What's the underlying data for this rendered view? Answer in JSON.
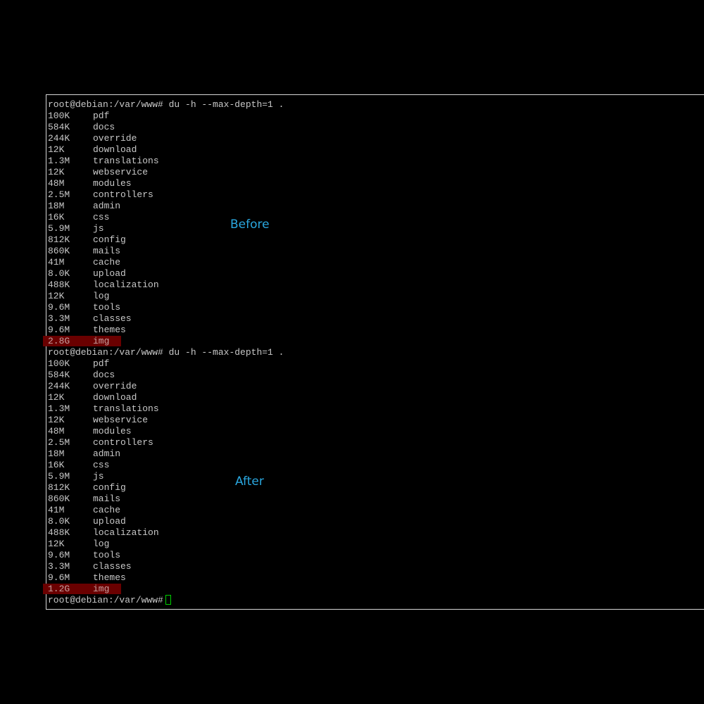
{
  "prompt": "root@debian:/var/www#",
  "command": " du -h --max-depth=1 .",
  "before_label": "Before",
  "after_label": "After",
  "colors": {
    "accent": "#2aa7df",
    "highlight": "#6a0000",
    "cursor": "#00d000",
    "text": "#c8c8c8"
  },
  "before_rows": [
    {
      "size": "100K",
      "name": "pdf"
    },
    {
      "size": "584K",
      "name": "docs"
    },
    {
      "size": "244K",
      "name": "override"
    },
    {
      "size": "12K",
      "name": "download"
    },
    {
      "size": "1.3M",
      "name": "translations"
    },
    {
      "size": "12K",
      "name": "webservice"
    },
    {
      "size": "48M",
      "name": "modules"
    },
    {
      "size": "2.5M",
      "name": "controllers"
    },
    {
      "size": "18M",
      "name": "admin"
    },
    {
      "size": "16K",
      "name": "css"
    },
    {
      "size": "5.9M",
      "name": "js"
    },
    {
      "size": "812K",
      "name": "config"
    },
    {
      "size": "860K",
      "name": "mails"
    },
    {
      "size": "41M",
      "name": "cache"
    },
    {
      "size": "8.0K",
      "name": "upload"
    },
    {
      "size": "488K",
      "name": "localization"
    },
    {
      "size": "12K",
      "name": "log"
    },
    {
      "size": "9.6M",
      "name": "tools"
    },
    {
      "size": "3.3M",
      "name": "classes"
    },
    {
      "size": "9.6M",
      "name": "themes"
    },
    {
      "size": "2.8G",
      "name": "img",
      "highlight": true
    }
  ],
  "after_rows": [
    {
      "size": "100K",
      "name": "pdf"
    },
    {
      "size": "584K",
      "name": "docs"
    },
    {
      "size": "244K",
      "name": "override"
    },
    {
      "size": "12K",
      "name": "download"
    },
    {
      "size": "1.3M",
      "name": "translations"
    },
    {
      "size": "12K",
      "name": "webservice"
    },
    {
      "size": "48M",
      "name": "modules"
    },
    {
      "size": "2.5M",
      "name": "controllers"
    },
    {
      "size": "18M",
      "name": "admin"
    },
    {
      "size": "16K",
      "name": "css"
    },
    {
      "size": "5.9M",
      "name": "js"
    },
    {
      "size": "812K",
      "name": "config"
    },
    {
      "size": "860K",
      "name": "mails"
    },
    {
      "size": "41M",
      "name": "cache"
    },
    {
      "size": "8.0K",
      "name": "upload"
    },
    {
      "size": "488K",
      "name": "localization"
    },
    {
      "size": "12K",
      "name": "log"
    },
    {
      "size": "9.6M",
      "name": "tools"
    },
    {
      "size": "3.3M",
      "name": "classes"
    },
    {
      "size": "9.6M",
      "name": "themes"
    },
    {
      "size": "1.2G",
      "name": "img",
      "highlight": true
    }
  ]
}
